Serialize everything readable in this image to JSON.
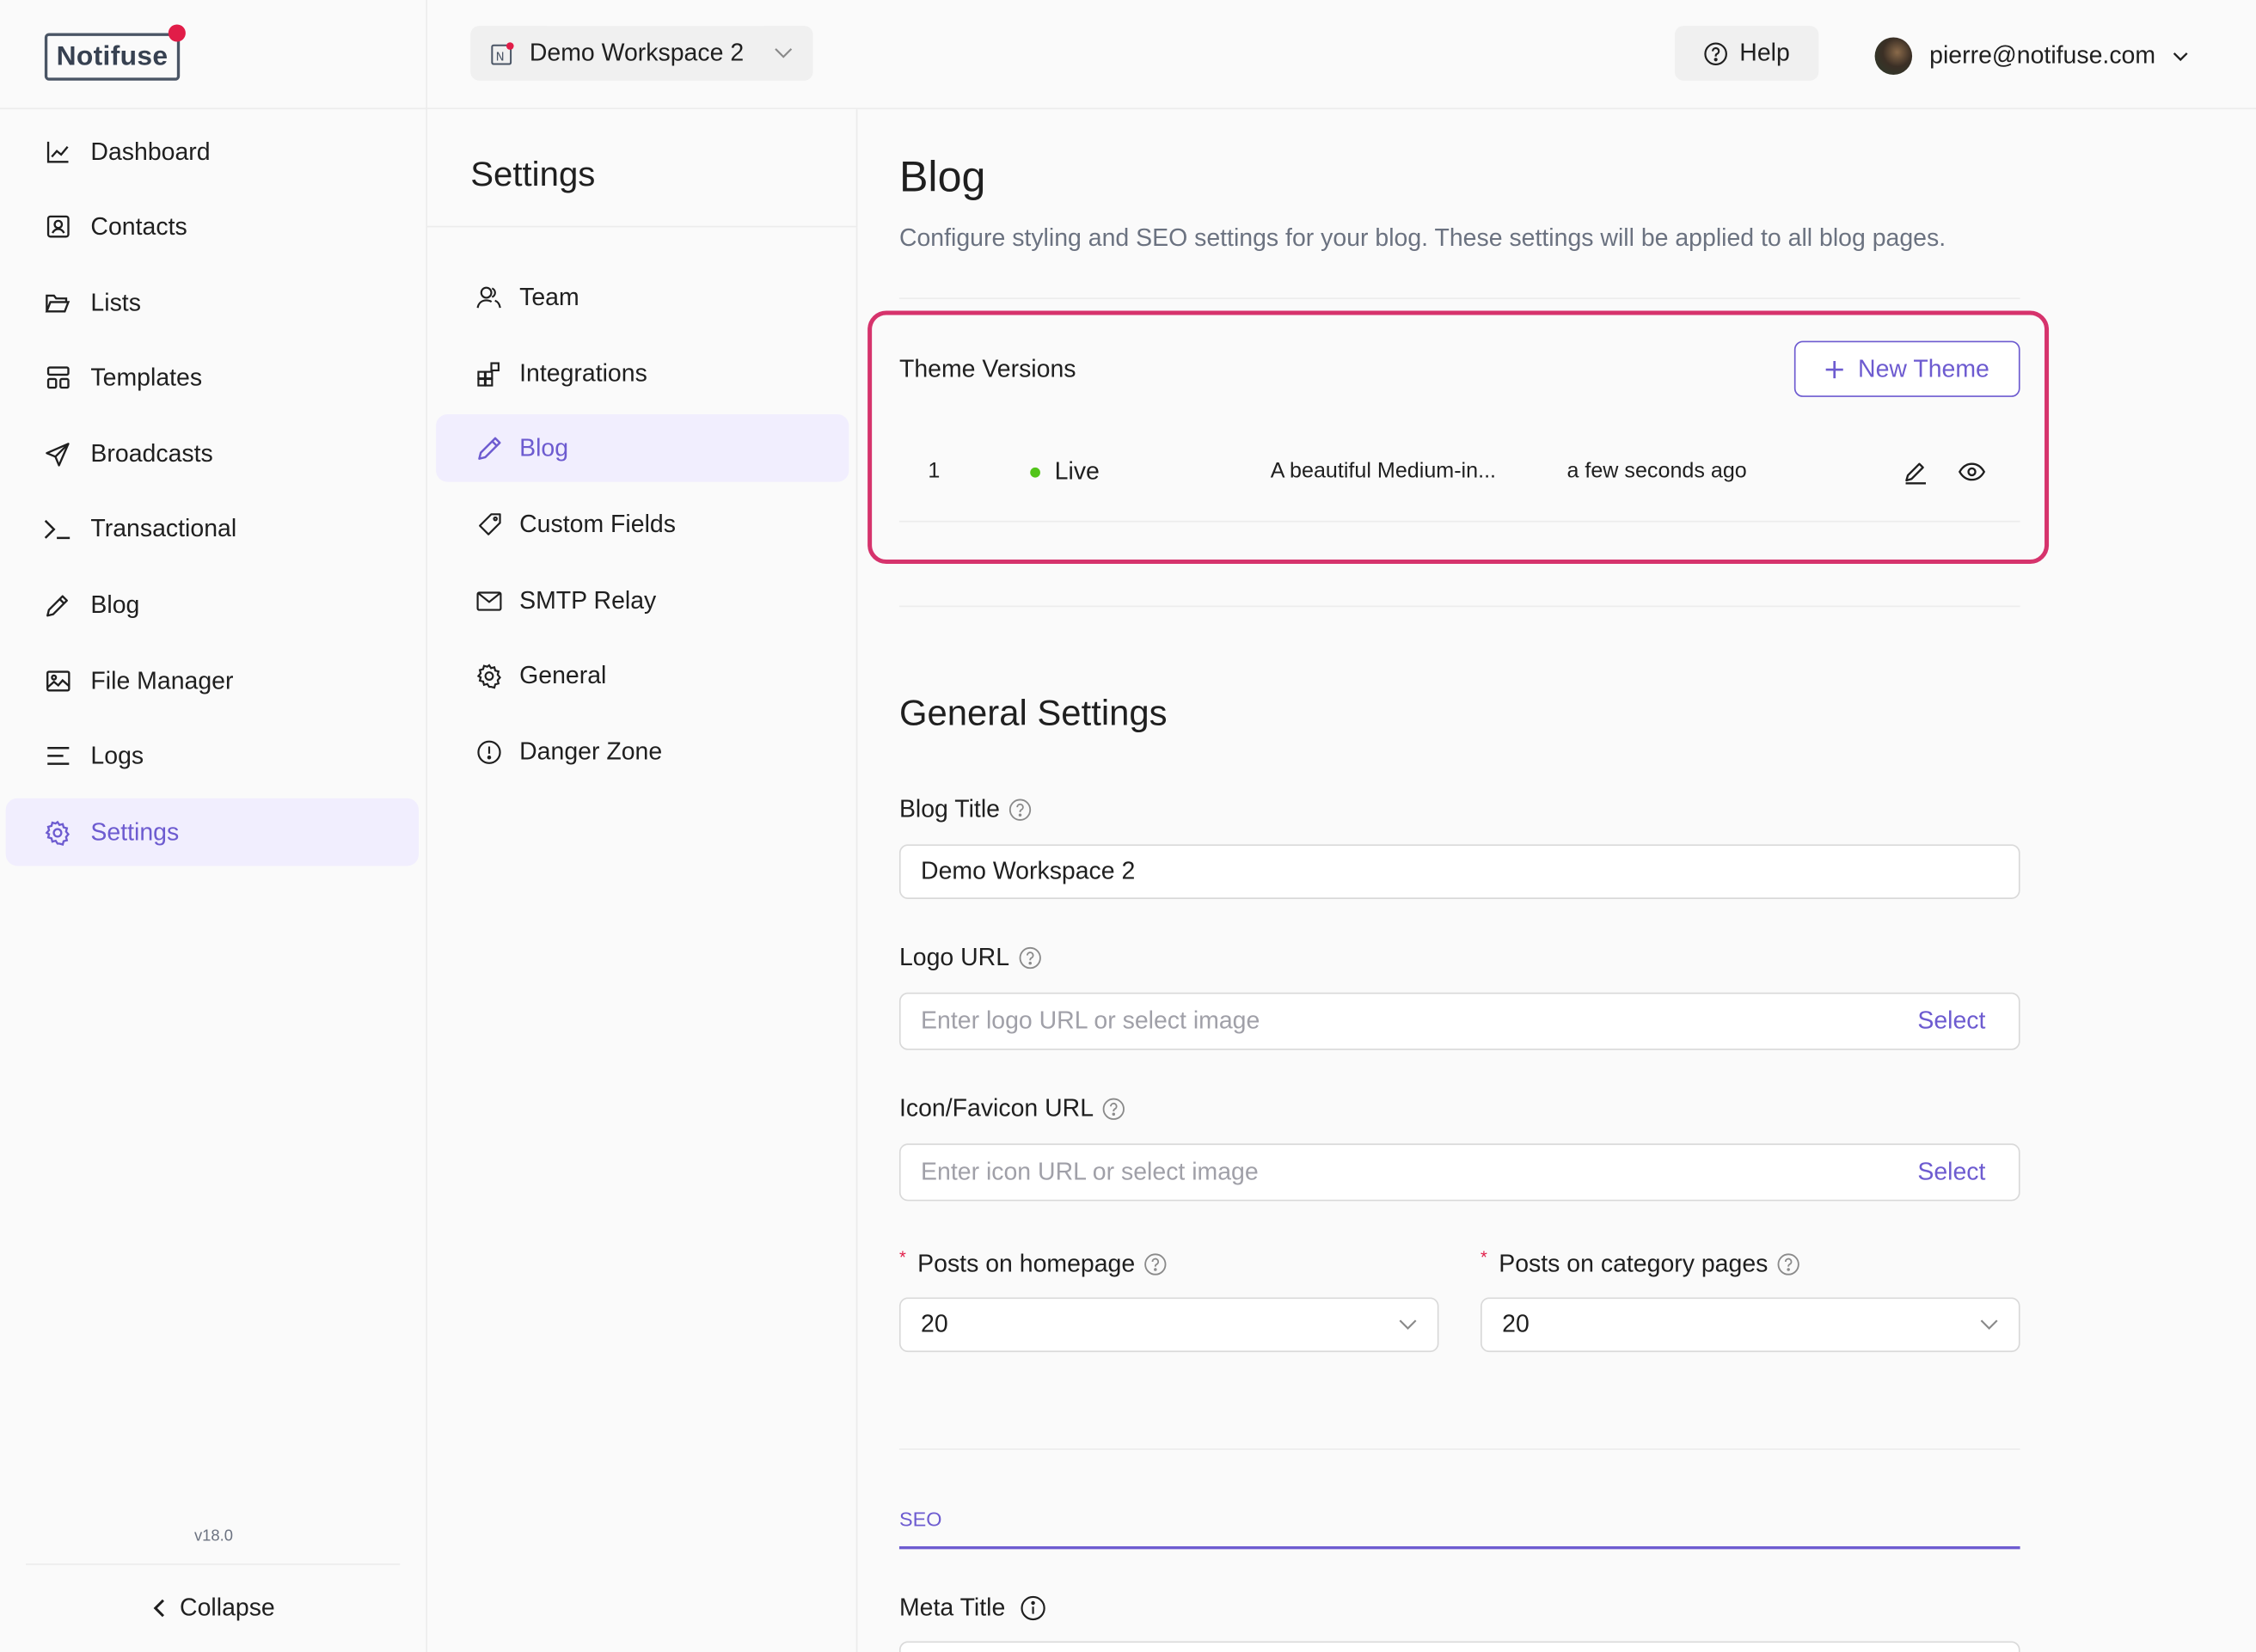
{
  "brand": {
    "logo_text": "Notifuse"
  },
  "nav": {
    "items": [
      {
        "label": "Dashboard",
        "icon": "chart-line-icon"
      },
      {
        "label": "Contacts",
        "icon": "contact-card-icon"
      },
      {
        "label": "Lists",
        "icon": "folder-open-icon"
      },
      {
        "label": "Templates",
        "icon": "layout-icon"
      },
      {
        "label": "Broadcasts",
        "icon": "send-icon"
      },
      {
        "label": "Transactional",
        "icon": "terminal-icon"
      },
      {
        "label": "Blog",
        "icon": "pen-icon"
      },
      {
        "label": "File Manager",
        "icon": "image-icon"
      },
      {
        "label": "Logs",
        "icon": "list-lines-icon"
      },
      {
        "label": "Settings",
        "icon": "gear-icon",
        "active": true
      }
    ],
    "version": "v18.0",
    "collapse_label": "Collapse"
  },
  "topbar": {
    "workspace": "Demo Workspace 2",
    "help_label": "Help",
    "user_email": "pierre@notifuse.com"
  },
  "settings_menu": {
    "title": "Settings",
    "items": [
      {
        "label": "Team",
        "icon": "team-icon"
      },
      {
        "label": "Integrations",
        "icon": "integrations-icon"
      },
      {
        "label": "Blog",
        "icon": "pen-icon",
        "active": true
      },
      {
        "label": "Custom Fields",
        "icon": "tag-icon"
      },
      {
        "label": "SMTP Relay",
        "icon": "mail-icon"
      },
      {
        "label": "General",
        "icon": "gear-icon"
      },
      {
        "label": "Danger Zone",
        "icon": "alert-circle-icon"
      }
    ]
  },
  "main": {
    "title": "Blog",
    "description": "Configure styling and SEO settings for your blog. These settings will be applied to all blog pages.",
    "theme_versions": {
      "title": "Theme Versions",
      "new_theme_label": "New Theme",
      "rows": [
        {
          "version": "1",
          "status": "Live",
          "description": "A beautiful Medium-in...",
          "updated": "a few seconds ago"
        }
      ]
    },
    "general": {
      "title": "General Settings",
      "blog_title_label": "Blog Title",
      "blog_title_value": "Demo Workspace 2",
      "logo_url_label": "Logo URL",
      "logo_url_placeholder": "Enter logo URL or select image",
      "icon_url_label": "Icon/Favicon URL",
      "icon_url_placeholder": "Enter icon URL or select image",
      "select_label": "Select",
      "posts_home_label": "Posts on homepage",
      "posts_home_value": "20",
      "posts_category_label": "Posts on category pages",
      "posts_category_value": "20"
    },
    "seo": {
      "tab_label": "SEO",
      "meta_title_label": "Meta Title"
    }
  },
  "colors": {
    "accent": "#6d5bd0",
    "highlight_border": "#d6336c",
    "live": "#52c41a"
  }
}
